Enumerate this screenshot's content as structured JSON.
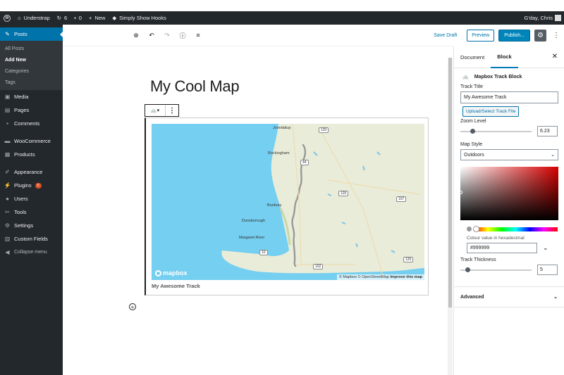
{
  "adminbar": {
    "site_name": "Understrap",
    "updates_count": "6",
    "comments_count": "0",
    "new_label": "New",
    "plugin_label": "Simply Show Hooks",
    "greeting": "G'day, Chris"
  },
  "sidebar": {
    "items": [
      {
        "label": "Posts",
        "icon": "pin-icon"
      },
      {
        "label": "Media",
        "icon": "media-icon"
      },
      {
        "label": "Pages",
        "icon": "pages-icon"
      },
      {
        "label": "Comments",
        "icon": "comments-icon"
      },
      {
        "label": "WooCommerce",
        "icon": "woocommerce-icon"
      },
      {
        "label": "Products",
        "icon": "products-icon"
      },
      {
        "label": "Appearance",
        "icon": "appearance-icon"
      },
      {
        "label": "Plugins",
        "icon": "plugins-icon",
        "badge": "5"
      },
      {
        "label": "Users",
        "icon": "users-icon"
      },
      {
        "label": "Tools",
        "icon": "tools-icon"
      },
      {
        "label": "Settings",
        "icon": "settings-icon"
      },
      {
        "label": "Custom Fields",
        "icon": "custom-fields-icon"
      },
      {
        "label": "Collapse menu",
        "icon": "collapse-icon"
      }
    ],
    "posts_submenu": [
      "All Posts",
      "Add New",
      "Categories",
      "Tags"
    ]
  },
  "toolbar": {
    "save_draft": "Save Draft",
    "preview": "Preview",
    "publish": "Publish..."
  },
  "post": {
    "title": "My Cool Map"
  },
  "map": {
    "places": [
      "Joondalup",
      "Rockingham",
      "Bunbury",
      "Dunsborough",
      "Margaret River"
    ],
    "roads": [
      "120",
      "44",
      "120",
      "107",
      "102",
      "10",
      "120"
    ],
    "logo": "mapbox",
    "attribution_1": "© Mapbox © OpenStreetMap",
    "attribution_2": "Improve this map",
    "caption": "My Awesome Track"
  },
  "panel": {
    "tab_document": "Document",
    "tab_block": "Block",
    "block_name": "Mapbox Track Block",
    "track_title_label": "Track Title",
    "track_title_value": "My Awesome Track",
    "upload_label": "Upload/Select Track File",
    "zoom_label": "Zoom Level",
    "zoom_value": "6.23",
    "zoom_fraction": 0.17,
    "map_style_label": "Map Style",
    "map_style_value": "Outdoors",
    "colour_hex_label": "Colour value in hexadecimal",
    "colour_hex_value": "#999999",
    "thickness_label": "Track Thickness",
    "thickness_value": "5",
    "thickness_fraction": 0.1,
    "advanced_label": "Advanced"
  },
  "colors": {
    "admin_dark": "#23282d",
    "accent": "#0073aa",
    "track": "#999999",
    "water": "#75cff0",
    "land": "#e9ecd9"
  }
}
